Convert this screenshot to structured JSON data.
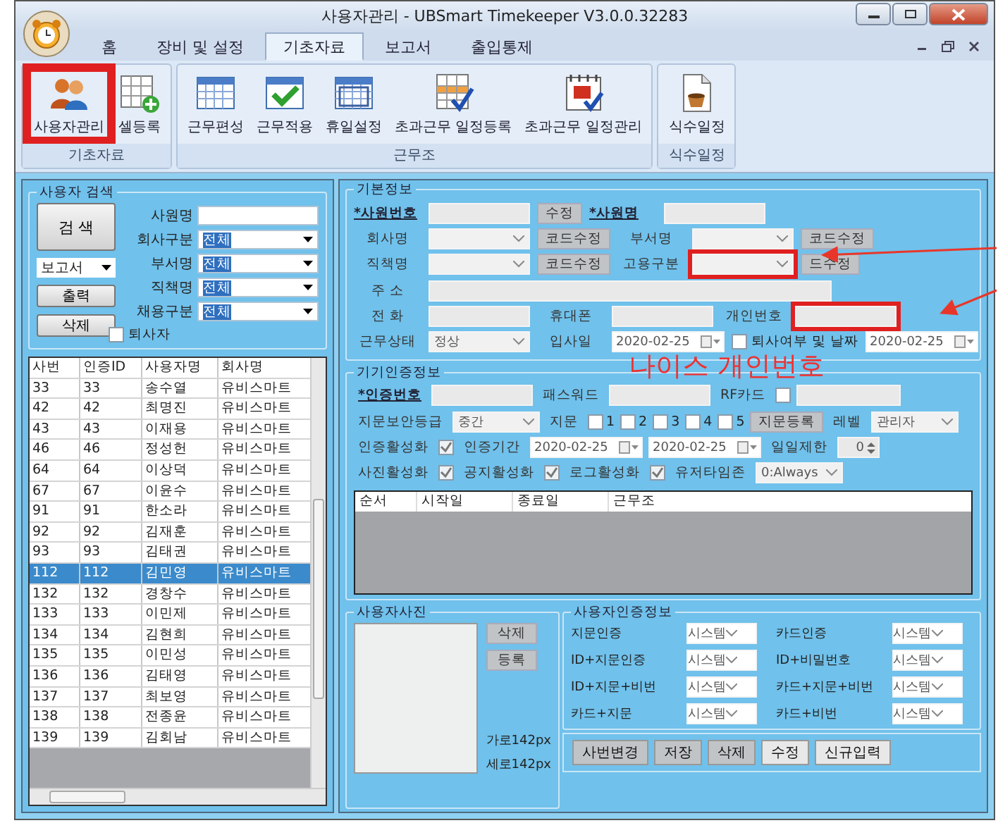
{
  "window": {
    "title": "사용자관리 - UBSmart Timekeeper V3.0.0.32283"
  },
  "ribbon_tabs": [
    {
      "label": "홈",
      "selected": false
    },
    {
      "label": "장비 및 설정",
      "selected": false
    },
    {
      "label": "기초자료",
      "selected": true
    },
    {
      "label": "보고서",
      "selected": false
    },
    {
      "label": "출입통제",
      "selected": false
    }
  ],
  "ribbon_groups": [
    {
      "label": "기초자료",
      "items": [
        {
          "label": "사용자관리",
          "kind": "users",
          "annotated": true
        },
        {
          "label": "셀등록",
          "kind": "sheet",
          "annotated": false
        }
      ]
    },
    {
      "label": "근무조",
      "items": [
        {
          "label": "근무편성",
          "kind": "plan",
          "annotated": false
        },
        {
          "label": "근무적용",
          "kind": "apply",
          "annotated": false
        },
        {
          "label": "휴일설정",
          "kind": "holiday",
          "annotated": false
        },
        {
          "label": "초과근무 일정등록",
          "kind": "register",
          "annotated": false
        },
        {
          "label": "초과근무 일정관리",
          "kind": "manage",
          "annotated": false
        }
      ]
    },
    {
      "label": "식수일정",
      "items": [
        {
          "label": "식수일정",
          "kind": "meal",
          "annotated": false
        }
      ]
    }
  ],
  "search": {
    "title": "사용자 검색",
    "button": "검 색",
    "report": "보고서",
    "print": "출력",
    "delete": "삭제",
    "retired": {
      "label": "퇴사자",
      "checked": false
    },
    "fields": [
      {
        "label": "사원명",
        "kind": "input"
      },
      {
        "label": "회사구분",
        "kind": "select",
        "value": "전체"
      },
      {
        "label": "부서명",
        "kind": "select",
        "value": "전체"
      },
      {
        "label": "직책명",
        "kind": "select",
        "value": "전체"
      },
      {
        "label": "채용구분",
        "kind": "select",
        "value": "전체"
      }
    ]
  },
  "user_table": {
    "columns": [
      "사번",
      "인증ID",
      "사용자명",
      "회사명"
    ],
    "rows": [
      {
        "cells": [
          "33",
          "33",
          "송수열",
          "유비스마트"
        ],
        "selected": false
      },
      {
        "cells": [
          "42",
          "42",
          "최명진",
          "유비스마트"
        ],
        "selected": false
      },
      {
        "cells": [
          "43",
          "43",
          "이재용",
          "유비스마트"
        ],
        "selected": false
      },
      {
        "cells": [
          "46",
          "46",
          "정성헌",
          "유비스마트"
        ],
        "selected": false
      },
      {
        "cells": [
          "64",
          "64",
          "이상덕",
          "유비스마트"
        ],
        "selected": false
      },
      {
        "cells": [
          "67",
          "67",
          "이윤수",
          "유비스마트"
        ],
        "selected": false
      },
      {
        "cells": [
          "91",
          "91",
          "한소라",
          "유비스마트"
        ],
        "selected": false
      },
      {
        "cells": [
          "92",
          "92",
          "김재훈",
          "유비스마트"
        ],
        "selected": false
      },
      {
        "cells": [
          "93",
          "93",
          "김태권",
          "유비스마트"
        ],
        "selected": false
      },
      {
        "cells": [
          "112",
          "112",
          "김민영",
          "유비스마트"
        ],
        "selected": true
      },
      {
        "cells": [
          "132",
          "132",
          "경창수",
          "유비스마트"
        ],
        "selected": false
      },
      {
        "cells": [
          "133",
          "133",
          "이민제",
          "유비스마트"
        ],
        "selected": false
      },
      {
        "cells": [
          "134",
          "134",
          "김현희",
          "유비스마트"
        ],
        "selected": false
      },
      {
        "cells": [
          "135",
          "135",
          "이민성",
          "유비스마트"
        ],
        "selected": false
      },
      {
        "cells": [
          "136",
          "136",
          "김태영",
          "유비스마트"
        ],
        "selected": false
      },
      {
        "cells": [
          "137",
          "137",
          "최보영",
          "유비스마트"
        ],
        "selected": false
      },
      {
        "cells": [
          "138",
          "138",
          "전종윤",
          "유비스마트"
        ],
        "selected": false
      },
      {
        "cells": [
          "139",
          "139",
          "김회남",
          "유비스마트"
        ],
        "selected": false
      }
    ]
  },
  "basic_info": {
    "title": "기본정보",
    "rows": [
      {
        "fields": [
          {
            "kind": "label",
            "text": "*사원번호",
            "required": true
          },
          {
            "kind": "input",
            "annotated": false
          },
          {
            "kind": "button",
            "text": "수정",
            "disabled": true
          },
          {
            "kind": "label",
            "text": "*사원명",
            "required": true
          },
          {
            "kind": "input",
            "annotated": false
          }
        ]
      },
      {
        "fields": [
          {
            "kind": "label",
            "text": "회사명",
            "required": false
          },
          {
            "kind": "select",
            "annotated": false
          },
          {
            "kind": "button",
            "text": "코드수정",
            "disabled": true
          },
          {
            "kind": "label",
            "text": "부서명",
            "required": false
          },
          {
            "kind": "select",
            "annotated": false
          },
          {
            "kind": "button",
            "text": "코드수정",
            "disabled": true
          }
        ]
      },
      {
        "fields": [
          {
            "kind": "label",
            "text": "직책명",
            "required": false
          },
          {
            "kind": "select",
            "annotated": false
          },
          {
            "kind": "button",
            "text": "코드수정",
            "disabled": true
          },
          {
            "kind": "label",
            "text": "고용구분",
            "required": false
          },
          {
            "kind": "select",
            "annotated": true
          },
          {
            "kind": "button",
            "text": "드수정",
            "disabled": true
          }
        ]
      },
      {
        "fields": [
          {
            "kind": "label",
            "text": "주    소",
            "required": false
          },
          {
            "kind": "long_input",
            "annotated": false
          }
        ]
      },
      {
        "fields": [
          {
            "kind": "label",
            "text": "전    화",
            "required": false
          },
          {
            "kind": "input",
            "annotated": false
          },
          {
            "kind": "label",
            "text": "휴대폰",
            "required": false
          },
          {
            "kind": "input",
            "annotated": false
          },
          {
            "kind": "label",
            "text": "개인번호",
            "required": false
          },
          {
            "kind": "input",
            "annotated": true
          }
        ]
      },
      {
        "fields": [
          {
            "kind": "label",
            "text": "근무상태",
            "required": false
          },
          {
            "kind": "select",
            "value": "정상",
            "annotated": false
          },
          {
            "kind": "label",
            "text": "입사일",
            "required": false
          },
          {
            "kind": "date",
            "value": "2020-02-25"
          },
          {
            "kind": "checkbox",
            "checked": false,
            "text": "퇴사여부 및 날짜"
          },
          {
            "kind": "date",
            "value": "2020-02-25"
          }
        ]
      }
    ]
  },
  "annotation": {
    "text": "나이스 개인번호"
  },
  "device_info": {
    "title": "기기인증정보",
    "rows": [
      {
        "fields": [
          {
            "kind": "label",
            "text": "*인증번호",
            "required": true
          },
          {
            "kind": "input",
            "annotated": false
          },
          {
            "kind": "label",
            "text": "패스워드",
            "required": false
          },
          {
            "kind": "input",
            "annotated": false
          },
          {
            "kind": "label",
            "text": "RF카드",
            "required": false
          },
          {
            "kind": "checkbox",
            "checked": false
          },
          {
            "kind": "long_input",
            "annotated": false
          }
        ]
      },
      {
        "fields": [
          {
            "kind": "label",
            "text": "지문보안등급",
            "required": false
          },
          {
            "kind": "select",
            "value": "중간",
            "annotated": false
          },
          {
            "kind": "label",
            "text": "지문",
            "required": false
          },
          {
            "kind": "checkbox",
            "checked": false,
            "text": "1"
          },
          {
            "kind": "checkbox",
            "checked": false,
            "text": "2"
          },
          {
            "kind": "checkbox",
            "checked": false,
            "text": "3"
          },
          {
            "kind": "checkbox",
            "checked": false,
            "text": "4"
          },
          {
            "kind": "checkbox",
            "checked": false,
            "text": "5"
          },
          {
            "kind": "button",
            "text": "지문등록",
            "disabled": true
          },
          {
            "kind": "label",
            "text": "레벨",
            "required": false
          },
          {
            "kind": "select",
            "value": "관리자",
            "annotated": false
          }
        ]
      },
      {
        "fields": [
          {
            "kind": "label",
            "text": "인증활성화",
            "required": false
          },
          {
            "kind": "checkbox",
            "checked": true
          },
          {
            "kind": "label",
            "text": "인증기간",
            "required": false
          },
          {
            "kind": "date",
            "value": "2020-02-25"
          },
          {
            "kind": "date",
            "value": "2020-02-25"
          },
          {
            "kind": "label",
            "text": "일일제한",
            "required": false
          },
          {
            "kind": "spin",
            "value": "0"
          }
        ]
      },
      {
        "fields": [
          {
            "kind": "label",
            "text": "사진활성화",
            "required": false
          },
          {
            "kind": "checkbox",
            "checked": true
          },
          {
            "kind": "label",
            "text": "공지활성화",
            "required": false
          },
          {
            "kind": "checkbox",
            "checked": true
          },
          {
            "kind": "label",
            "text": "로그활성화",
            "required": false
          },
          {
            "kind": "checkbox",
            "checked": true
          },
          {
            "kind": "label",
            "text": "유저타임존",
            "required": false
          },
          {
            "kind": "select",
            "value": "0:Always",
            "annotated": false
          }
        ]
      }
    ],
    "schedule_columns": [
      "순서",
      "시작일",
      "종료일",
      "근무조"
    ]
  },
  "photo": {
    "title": "사용자사진",
    "buttons": [
      {
        "text": "삭제",
        "disabled": true
      },
      {
        "text": "등록",
        "disabled": true
      }
    ],
    "width_note": "가로142px",
    "height_note": "세로142px"
  },
  "auth_methods": {
    "title": "사용자인증정보",
    "items": [
      {
        "label": "지문인증",
        "value": "시스템"
      },
      {
        "label": "카드인증",
        "value": "시스템"
      },
      {
        "label": "ID+지문인증",
        "value": "시스템"
      },
      {
        "label": "ID+비밀번호",
        "value": "시스템"
      },
      {
        "label": "ID+지문+비번",
        "value": "시스템"
      },
      {
        "label": "카드+지문+비번",
        "value": "시스템"
      },
      {
        "label": "카드+지문",
        "value": "시스템"
      },
      {
        "label": "카드+비번",
        "value": "시스템"
      }
    ]
  },
  "actions": [
    {
      "text": "사번변경",
      "disabled": true
    },
    {
      "text": "저장",
      "disabled": true
    },
    {
      "text": "삭제",
      "disabled": true
    },
    {
      "text": "수정",
      "disabled": false
    },
    {
      "text": "신규입력",
      "disabled": false
    }
  ]
}
